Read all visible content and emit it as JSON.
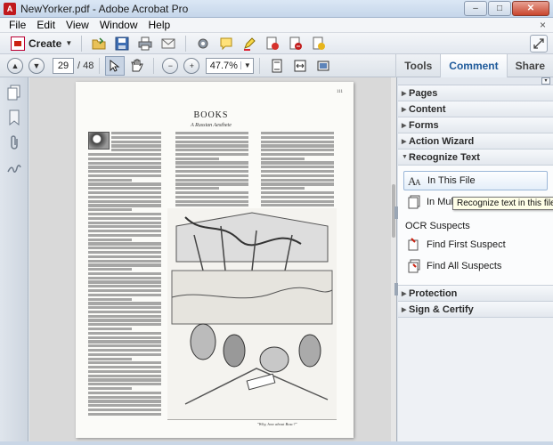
{
  "window": {
    "title": "NewYorker.pdf - Adobe Acrobat Pro",
    "app_icon_glyph": "A",
    "controls": {
      "minimize": "–",
      "maximize": "□",
      "close": "✕"
    }
  },
  "menubar": {
    "items": [
      "File",
      "Edit",
      "View",
      "Window",
      "Help"
    ],
    "close_glyph": "×"
  },
  "toolbar": {
    "create_label": "Create",
    "icons": [
      "open-folder-icon",
      "save-icon",
      "print-icon",
      "email-icon",
      "gear-icon",
      "comment-icon",
      "highlight-icon",
      "sign-icon",
      "share-icon",
      "stamp-icon"
    ]
  },
  "navigation": {
    "current_page": "29",
    "total_pages": "/ 48",
    "zoom": "47.7%"
  },
  "right_tabs": [
    "Tools",
    "Comment",
    "Share"
  ],
  "document": {
    "page_number": "111",
    "header": "BOOKS",
    "subheader": "A Russian Aesthete",
    "caption": "\"Why, how about Bosc?\""
  },
  "panel": {
    "sections_top": [
      "Pages",
      "Content",
      "Forms",
      "Action Wizard"
    ],
    "recognize_text": {
      "title": "Recognize Text",
      "actions": [
        "In This File",
        "In Multiple Files"
      ],
      "ocr_heading": "OCR Suspects",
      "ocr_actions": [
        "Find First Suspect",
        "Find All Suspects"
      ]
    },
    "sections_bottom": [
      "Protection",
      "Sign & Certify"
    ]
  },
  "tooltip": "Recognize text in this file",
  "colors": {
    "accent": "#1e5a9a",
    "close_button": "#c9462e",
    "acrobat_red": "#c0191e"
  }
}
